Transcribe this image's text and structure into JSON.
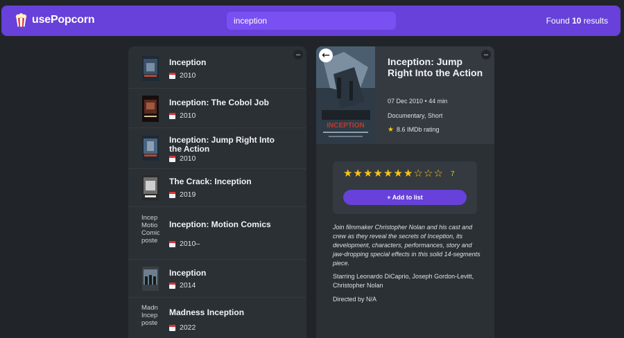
{
  "nav": {
    "logo_text": "usePopcorn",
    "search_value": "inception",
    "results_prefix": "Found ",
    "results_count": "10",
    "results_suffix": " results"
  },
  "list": {
    "toggle_label": "–",
    "items": [
      {
        "title": "Inception",
        "year": "2010"
      },
      {
        "title": "Inception: The Cobol Job",
        "year": "2010"
      },
      {
        "title": "Inception: Jump Right Into the Action",
        "year": "2010"
      },
      {
        "title": "The Crack: Inception",
        "year": "2019"
      },
      {
        "title": "Inception: Motion Comics",
        "year": "2010–",
        "poster_alt": "Incep\nMotio\nComic\nposte"
      },
      {
        "title": "Inception",
        "year": "2014"
      },
      {
        "title": "Madness Inception",
        "year": "2022",
        "poster_alt": "Madn\nIncep\nposte"
      }
    ]
  },
  "details": {
    "toggle_label": "–",
    "back_label": "←",
    "title": "Inception: Jump Right Into the Action",
    "released_runtime": "07 Dec 2010 • 44 min",
    "genre": "Documentary, Short",
    "imdb_rating": "8.6 IMDb rating",
    "user_rating": "7",
    "max_rating": 10,
    "add_button": "+ Add to list",
    "plot": "Join filmmaker Christopher Nolan and his cast and crew as they reveal the secrets of Inception, its development, characters, performances, story and jaw-dropping special effects in this solid 14-segments piece.",
    "starring": "Starring Leonardo DiCaprio, Joseph Gordon-Levitt, Christopher Nolan",
    "directed": "Directed by N/A",
    "poster_caption": "INCEPTION"
  },
  "colors": {
    "primary": "#6741d9",
    "primary_light": "#7950f2",
    "background": "#212529",
    "box": "#2b3035",
    "star": "#fcc419"
  }
}
